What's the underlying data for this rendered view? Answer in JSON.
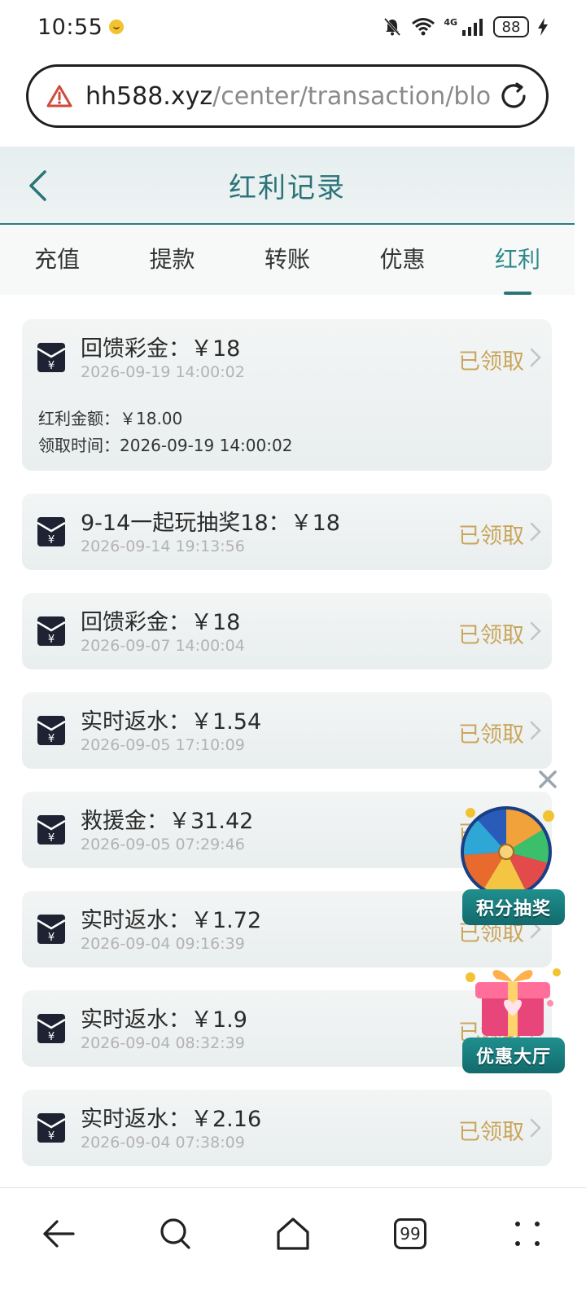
{
  "status_bar": {
    "time": "10:55",
    "network": "4G",
    "battery": "88"
  },
  "browser": {
    "url_host": "hh588.xyz",
    "url_path": "/center/transaction/blo"
  },
  "header": {
    "title": "红利记录"
  },
  "tabs": [
    {
      "label": "充值"
    },
    {
      "label": "提款"
    },
    {
      "label": "转账"
    },
    {
      "label": "优惠"
    },
    {
      "label": "红利"
    }
  ],
  "active_tab": "红利",
  "records": [
    {
      "title": "回馈彩金：￥18",
      "time": "2026-09-19 14:00:02",
      "status": "已领取",
      "expanded": true,
      "detail_amount_label": "红利金额：",
      "detail_amount": "￥18.00",
      "detail_time_label": "领取时间：",
      "detail_time": "2026-09-19 14:00:02"
    },
    {
      "title": "9-14一起玩抽奖18：￥18",
      "time": "2026-09-14 19:13:56",
      "status": "已领取"
    },
    {
      "title": "回馈彩金：￥18",
      "time": "2026-09-07 14:00:04",
      "status": "已领取"
    },
    {
      "title": "实时返水：￥1.54",
      "time": "2026-09-05 17:10:09",
      "status": "已领取"
    },
    {
      "title": "救援金：￥31.42",
      "time": "2026-09-05 07:29:46",
      "status": "已领取"
    },
    {
      "title": "实时返水：￥1.72",
      "time": "2026-09-04 09:16:39",
      "status": "已领取"
    },
    {
      "title": "实时返水：￥1.9",
      "time": "2026-09-04 08:32:39",
      "status": "已领取"
    },
    {
      "title": "实时返水：￥2.16",
      "time": "2026-09-04 07:38:09",
      "status": "已领取"
    }
  ],
  "floating": {
    "lottery_label": "积分抽奖",
    "promo_hall_label": "优惠大厅"
  },
  "bottom_nav": {
    "tab_count": "99"
  },
  "colors": {
    "accent": "#2b7478",
    "status_gold": "#c9a65c"
  }
}
